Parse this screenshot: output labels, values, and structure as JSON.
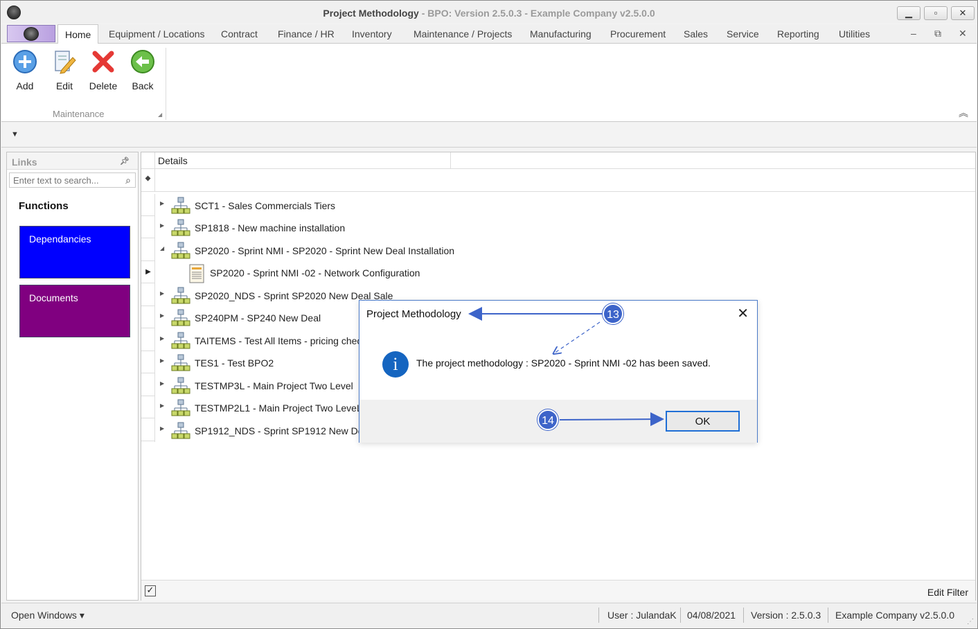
{
  "window": {
    "title_main": "Project Methodology",
    "title_rest": " - BPO: Version 2.5.0.3 - Example Company v2.5.0.0",
    "minimize": "▁",
    "maximize": "▫",
    "close": "✕"
  },
  "menu": {
    "tabs": [
      "Home",
      "Equipment / Locations",
      "Contract",
      "Finance / HR",
      "Inventory",
      "Maintenance / Projects",
      "Manufacturing",
      "Procurement",
      "Sales",
      "Service",
      "Reporting",
      "Utilities"
    ],
    "active_tab": "Home",
    "mdi_min": "–",
    "mdi_restore": "⧉",
    "mdi_close": "✕"
  },
  "ribbon": {
    "buttons": [
      {
        "label": "Add",
        "icon": "add-icon"
      },
      {
        "label": "Edit",
        "icon": "edit-icon"
      },
      {
        "label": "Delete",
        "icon": "delete-icon"
      },
      {
        "label": "Back",
        "icon": "back-icon"
      }
    ],
    "group_label": "Maintenance",
    "collapse": "︽"
  },
  "links": {
    "header": "Links",
    "search_placeholder": "Enter text to search...",
    "functions_title": "Functions",
    "functions": [
      {
        "label": "Dependancies",
        "color": "#0000ff"
      },
      {
        "label": "Documents",
        "color": "#800080"
      }
    ]
  },
  "grid": {
    "column_header": "Details",
    "rows": [
      {
        "label": "SCT1 - Sales Commercials Tiers",
        "expanded": false,
        "child": false
      },
      {
        "label": "SP1818 - New machine installation",
        "expanded": false,
        "child": false
      },
      {
        "label": "SP2020 - Sprint NMI - SP2020 - Sprint New Deal Installation",
        "expanded": true,
        "child": false
      },
      {
        "label": "SP2020 - Sprint NMI -02 - Network Configuration",
        "expanded": false,
        "child": true,
        "selected": true
      },
      {
        "label": "SP2020_NDS - Sprint SP2020 New Deal Sale",
        "expanded": false,
        "child": false
      },
      {
        "label": "SP240PM - SP240 New Deal",
        "expanded": false,
        "child": false
      },
      {
        "label": "TAITEMS - Test All Items - pricing check",
        "expanded": false,
        "child": false
      },
      {
        "label": "TES1 - Test BPO2",
        "expanded": false,
        "child": false
      },
      {
        "label": "TESTMP3L - Main Project Two Level",
        "expanded": false,
        "child": false
      },
      {
        "label": "TESTMP2L1 - Main Project Two LeveL",
        "expanded": false,
        "child": false
      },
      {
        "label": "SP1912_NDS - Sprint SP1912 New Deal",
        "expanded": false,
        "child": false
      }
    ],
    "footer_check": "✓",
    "edit_filter": "Edit Filter"
  },
  "status": {
    "open_windows": "Open Windows ▾",
    "user": "User : JulandaK",
    "date": "04/08/2021",
    "version": "Version : 2.5.0.3",
    "company": "Example Company v2.5.0.0"
  },
  "dialog": {
    "title": "Project Methodology",
    "close": "✕",
    "info_glyph": "i",
    "message": "The project methodology : SP2020 - Sprint NMI -02 has been saved.",
    "ok": "OK"
  },
  "callouts": {
    "step13": "13",
    "step14": "14",
    "color": "#3d64c9"
  }
}
